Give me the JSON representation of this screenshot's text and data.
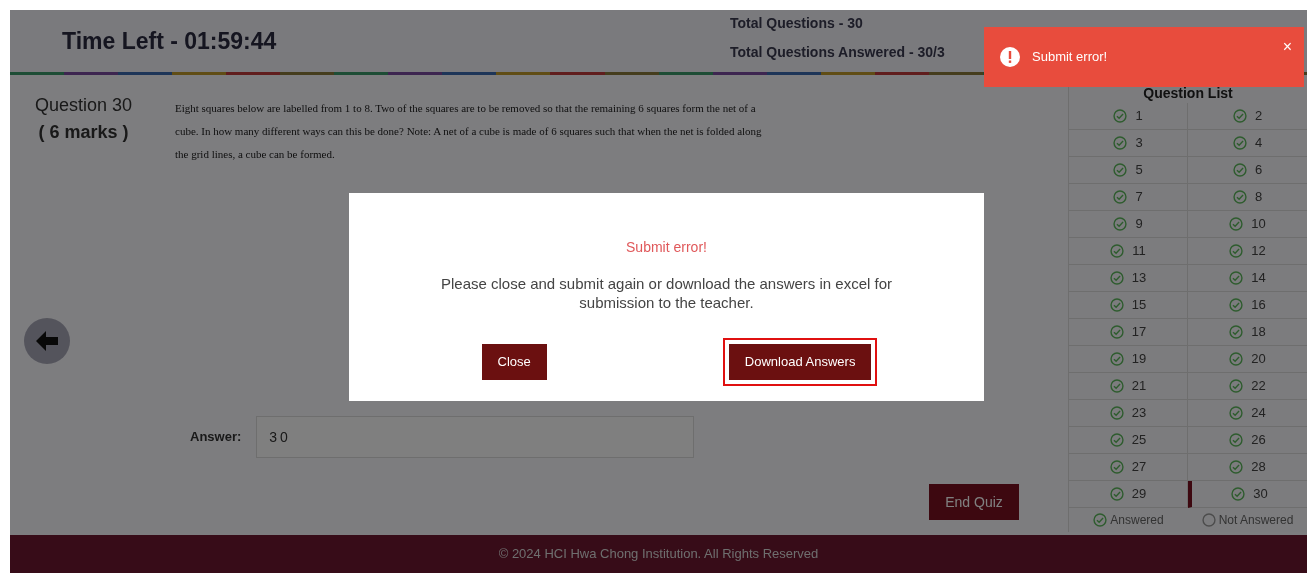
{
  "header": {
    "time_left": "Time Left - 01:59:44",
    "total_questions": "Total Questions - 30",
    "total_answered": "Total Questions Answered - 30/3"
  },
  "question": {
    "title": "Question 30",
    "marks": "( 6 marks )",
    "text": "Eight squares below are labelled from 1 to 8. Two of the squares are to be removed so that the remaining 6 squares form the net of a cube. In how many different ways can this be done? Note: A net of a cube is made of 6 squares such that when the net is folded along the grid lines, a cube can be formed."
  },
  "answer": {
    "label": "Answer:",
    "value": "30"
  },
  "end_button": "End Quiz",
  "question_list": {
    "title": "Question List",
    "items": [
      {
        "label": "1",
        "answered": true,
        "current": false
      },
      {
        "label": "2",
        "answered": true,
        "current": false
      },
      {
        "label": "3",
        "answered": true,
        "current": false
      },
      {
        "label": "4",
        "answered": true,
        "current": false
      },
      {
        "label": "5",
        "answered": true,
        "current": false
      },
      {
        "label": "6",
        "answered": true,
        "current": false
      },
      {
        "label": "7",
        "answered": true,
        "current": false
      },
      {
        "label": "8",
        "answered": true,
        "current": false
      },
      {
        "label": "9",
        "answered": true,
        "current": false
      },
      {
        "label": "10",
        "answered": true,
        "current": false
      },
      {
        "label": "11",
        "answered": true,
        "current": false
      },
      {
        "label": "12",
        "answered": true,
        "current": false
      },
      {
        "label": "13",
        "answered": true,
        "current": false
      },
      {
        "label": "14",
        "answered": true,
        "current": false
      },
      {
        "label": "15",
        "answered": true,
        "current": false
      },
      {
        "label": "16",
        "answered": true,
        "current": false
      },
      {
        "label": "17",
        "answered": true,
        "current": false
      },
      {
        "label": "18",
        "answered": true,
        "current": false
      },
      {
        "label": "19",
        "answered": true,
        "current": false
      },
      {
        "label": "20",
        "answered": true,
        "current": false
      },
      {
        "label": "21",
        "answered": true,
        "current": false
      },
      {
        "label": "22",
        "answered": true,
        "current": false
      },
      {
        "label": "23",
        "answered": true,
        "current": false
      },
      {
        "label": "24",
        "answered": true,
        "current": false
      },
      {
        "label": "25",
        "answered": true,
        "current": false
      },
      {
        "label": "26",
        "answered": true,
        "current": false
      },
      {
        "label": "27",
        "answered": true,
        "current": false
      },
      {
        "label": "28",
        "answered": true,
        "current": false
      },
      {
        "label": "29",
        "answered": true,
        "current": false
      },
      {
        "label": "30",
        "answered": true,
        "current": true
      }
    ],
    "legend": [
      {
        "label": "Answered",
        "answered": true
      },
      {
        "label": "Not Answered",
        "answered": false
      }
    ]
  },
  "footer": "© 2024 HCI Hwa Chong Institution. All Rights Reserved",
  "modal": {
    "title": "Submit error!",
    "message": "Please close and submit again or download the answers in excel for submission to the teacher.",
    "buttons": [
      {
        "label": "Close",
        "highlighted": false
      },
      {
        "label": "Download Answers",
        "highlighted": true
      }
    ]
  },
  "toast": {
    "message": "Submit error!",
    "close": "×"
  }
}
